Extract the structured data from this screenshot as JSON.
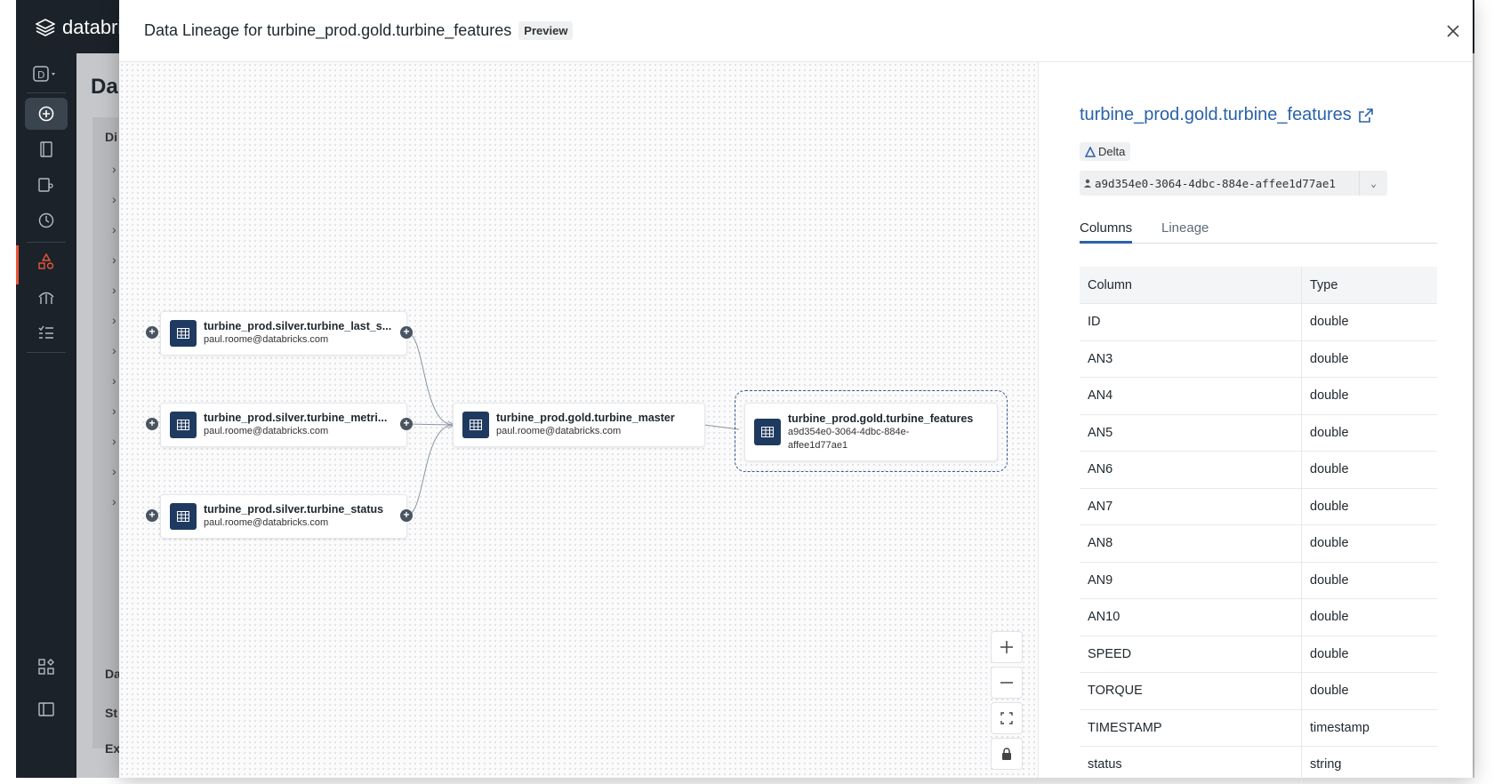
{
  "app": {
    "brand": "databricks",
    "page_title_partial": "Da",
    "bg_labels": [
      "Da",
      "Di",
      "St",
      "Ex"
    ]
  },
  "modal": {
    "title": "Data Lineage for turbine_prod.gold.turbine_features",
    "preview_badge": "Preview",
    "close_label": "×"
  },
  "graph": {
    "upstream": [
      {
        "name": "turbine_prod.silver.turbine_last_s...",
        "owner": "paul.roome@databricks.com"
      },
      {
        "name": "turbine_prod.silver.turbine_metri...",
        "owner": "paul.roome@databricks.com"
      },
      {
        "name": "turbine_prod.silver.turbine_status",
        "owner": "paul.roome@databricks.com"
      }
    ],
    "master": {
      "name": "turbine_prod.gold.turbine_master",
      "owner": "paul.roome@databricks.com"
    },
    "selected": {
      "name": "turbine_prod.gold.turbine_features",
      "owner_line1": "a9d354e0-3064-4dbc-884e-",
      "owner_line2": "affee1d77ae1"
    },
    "controls": {
      "zoom_in": "+",
      "zoom_out": "—"
    }
  },
  "side": {
    "title": "turbine_prod.gold.turbine_features",
    "format": "Delta",
    "owner": "a9d354e0-3064-4dbc-884e-affee1d77ae1",
    "tabs": [
      "Columns",
      "Lineage"
    ],
    "active_tab": "Columns",
    "table": {
      "headers": [
        "Column",
        "Type"
      ],
      "rows": [
        [
          "ID",
          "double"
        ],
        [
          "AN3",
          "double"
        ],
        [
          "AN4",
          "double"
        ],
        [
          "AN5",
          "double"
        ],
        [
          "AN6",
          "double"
        ],
        [
          "AN7",
          "double"
        ],
        [
          "AN8",
          "double"
        ],
        [
          "AN9",
          "double"
        ],
        [
          "AN10",
          "double"
        ],
        [
          "SPEED",
          "double"
        ],
        [
          "TORQUE",
          "double"
        ],
        [
          "TIMESTAMP",
          "timestamp"
        ],
        [
          "status",
          "string"
        ]
      ]
    }
  },
  "colors": {
    "accent": "#2b62a8",
    "node_icon": "#1f3a60",
    "sidebar": "#1b2229",
    "alert": "#e8563c"
  }
}
